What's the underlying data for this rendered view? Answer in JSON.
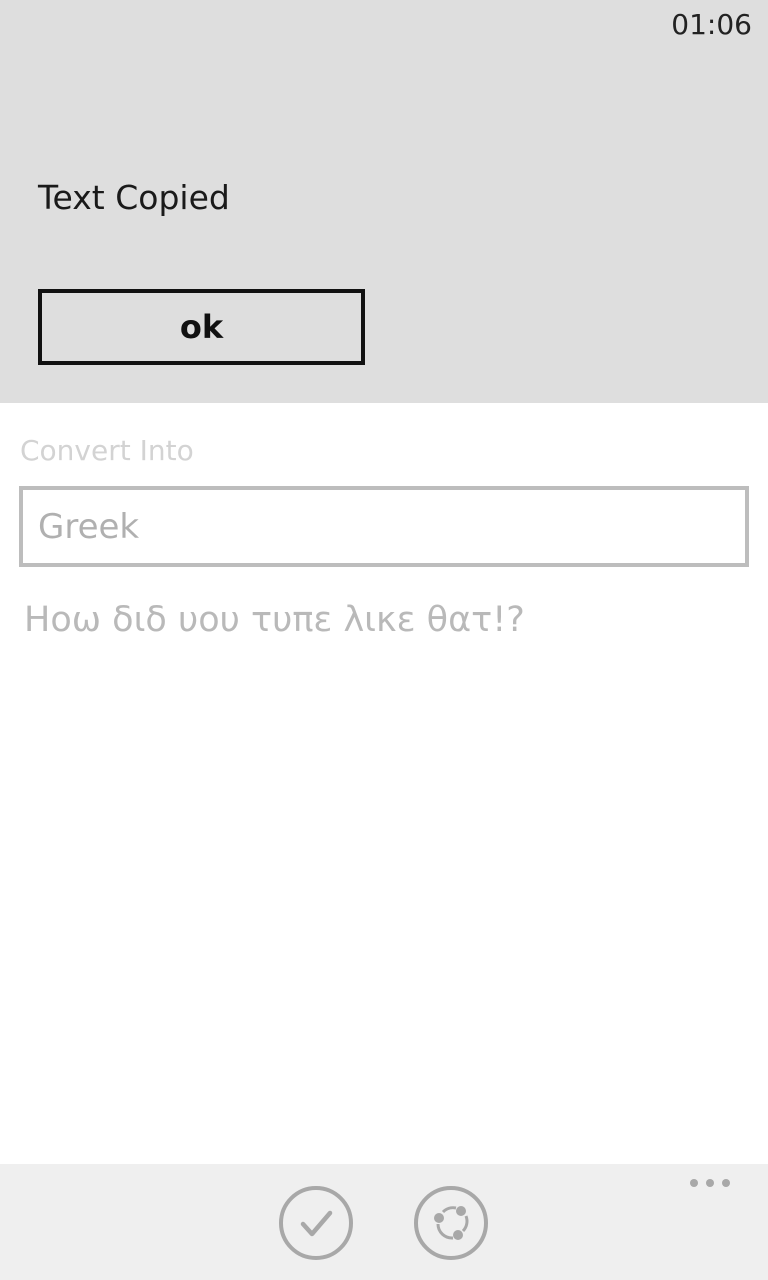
{
  "status_bar": {
    "time": "01:06"
  },
  "dialog": {
    "message": "Text Copied",
    "ok_label": "ok"
  },
  "form": {
    "convert_label": "Convert Into",
    "language_value": "Greek",
    "converted_text": "Ηοω διδ υου τυπε λικε θατ!?"
  },
  "app_bar": {
    "buttons": [
      {
        "icon": "check-icon"
      },
      {
        "icon": "share-icon"
      }
    ],
    "more_icon": "ellipsis-icon"
  },
  "colors": {
    "dialog_bg": "#dedede",
    "appbar_bg": "#efefef",
    "disabled_text": "#b9b9b9"
  }
}
